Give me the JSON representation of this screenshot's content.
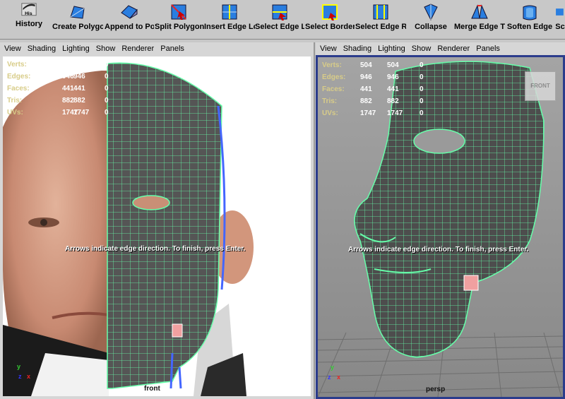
{
  "shelf": {
    "tools": [
      {
        "label": "History",
        "icon": "history-icon",
        "badge": "His"
      },
      {
        "label": "Create Polygon",
        "icon": "create-polygon-icon"
      },
      {
        "label": "Append to Pol",
        "icon": "append-polygon-icon"
      },
      {
        "label": "Split Polygon",
        "icon": "split-polygon-icon"
      },
      {
        "label": "Insert Edge Lc",
        "icon": "insert-edge-loop-icon"
      },
      {
        "label": "Select Edge L",
        "icon": "select-edge-loop-icon"
      },
      {
        "label": "Select Border",
        "icon": "select-border-icon"
      },
      {
        "label": "Select Edge R",
        "icon": "select-edge-ring-icon"
      },
      {
        "label": "Collapse",
        "icon": "collapse-icon"
      },
      {
        "label": "Merge Edge T",
        "icon": "merge-edge-icon"
      },
      {
        "label": "Soften Edge",
        "icon": "soften-edge-icon"
      },
      {
        "label": "Sc",
        "icon": "tool-icon"
      }
    ]
  },
  "menu": [
    "View",
    "Shading",
    "Lighting",
    "Show",
    "Renderer",
    "Panels"
  ],
  "hud": {
    "rows": [
      {
        "label": "Verts:",
        "a": "504",
        "b": "504",
        "c": "0"
      },
      {
        "label": "Edges:",
        "a": "946",
        "b": "946",
        "c": "0"
      },
      {
        "label": "Faces:",
        "a": "441",
        "b": "441",
        "c": "0"
      },
      {
        "label": "Tris:",
        "a": "882",
        "b": "882",
        "c": "0"
      },
      {
        "label": "UVs:",
        "a": "1747",
        "b": "1747",
        "c": "0"
      }
    ]
  },
  "left_panel": {
    "message": "Arrows indicate edge direction. To finish, press Enter.",
    "camera": "front"
  },
  "right_panel": {
    "message": "Arrows indicate edge direction. To finish, press Enter.",
    "camera": "persp",
    "view_cube": "FRONT"
  },
  "axes": {
    "y": "y",
    "z": "z",
    "x": "x"
  },
  "colors": {
    "wire": "#66ffaa",
    "hud_label": "#d8cc88",
    "active_border": "#2b3c8c",
    "selected_face": "#f0a0a0"
  }
}
